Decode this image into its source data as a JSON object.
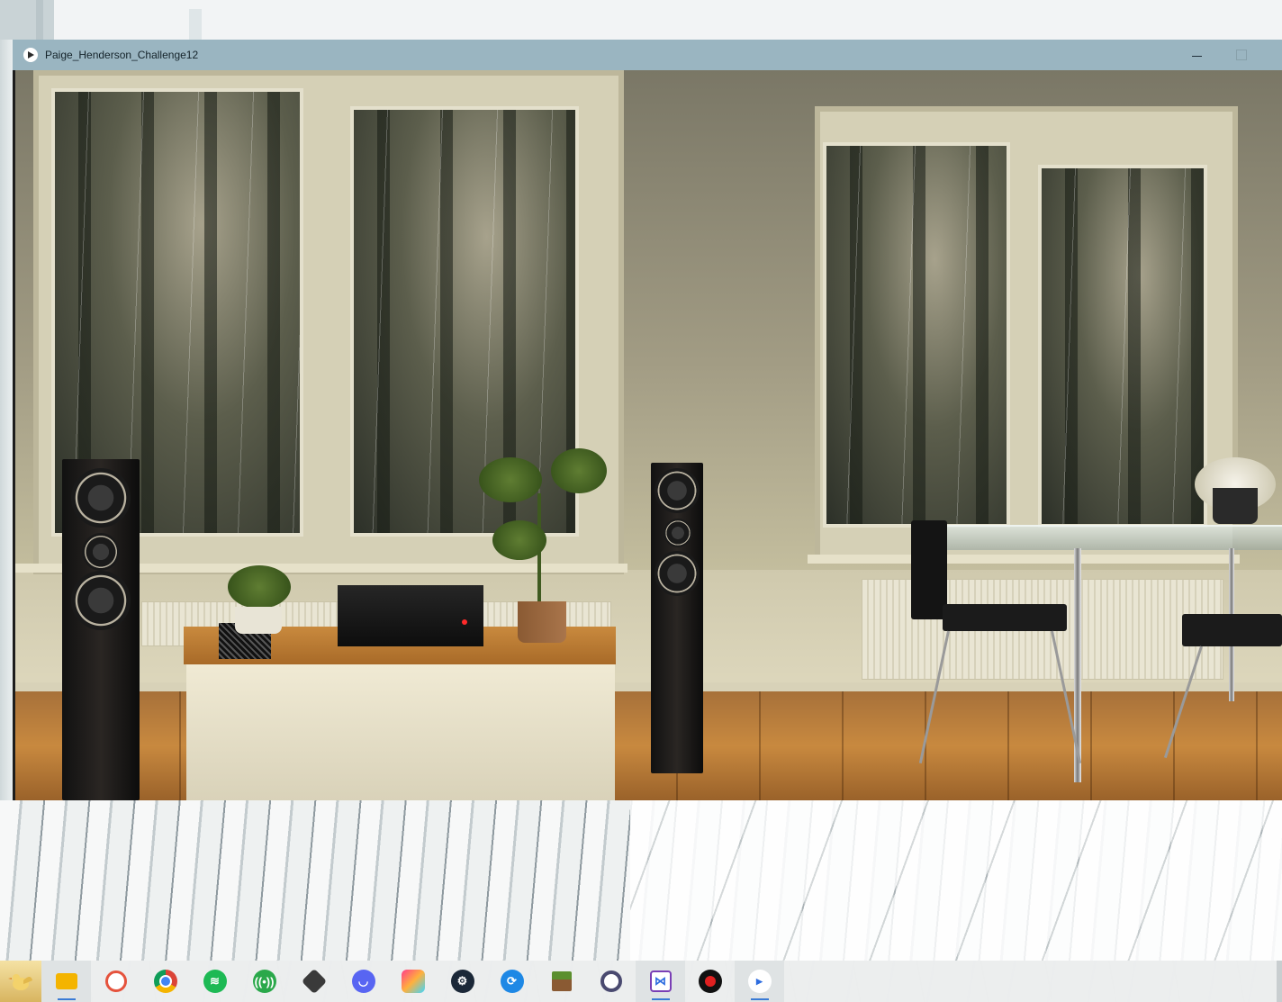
{
  "window": {
    "title": "Paige_Henderson_Challenge12",
    "icon": "play-icon",
    "controls": {
      "minimize_icon": "minimize-icon",
      "maximize_icon": "maximize-icon"
    }
  },
  "video": {
    "content": "rainy-forest-room-scene"
  },
  "taskbar": {
    "start_icon": "start-bird-icon",
    "apps": [
      {
        "name": "file-explorer",
        "icon": "folder-icon",
        "color": "#f4b400"
      },
      {
        "name": "recolored-paint",
        "icon": "spiral-icon",
        "color": "#e5533d"
      },
      {
        "name": "chrome",
        "icon": "chrome-icon",
        "color": "#db4437"
      },
      {
        "name": "spotify",
        "icon": "spotify-icon",
        "color": "#1db954"
      },
      {
        "name": "podcast",
        "icon": "broadcast-icon",
        "color": "#2aa84a"
      },
      {
        "name": "unity",
        "icon": "cube-icon",
        "color": "#333333"
      },
      {
        "name": "discord",
        "icon": "discord-icon",
        "color": "#5865f2"
      },
      {
        "name": "photo-app",
        "icon": "gallery-icon",
        "color": "#ff6a3d"
      },
      {
        "name": "steam",
        "icon": "steam-icon",
        "color": "#1b2838"
      },
      {
        "name": "network",
        "icon": "network-icon",
        "color": "#1e88e5"
      },
      {
        "name": "minecraft",
        "icon": "grass-block-icon",
        "color": "#5b8f2e"
      },
      {
        "name": "obs-style",
        "icon": "ring-icon",
        "color": "#4a4a70"
      },
      {
        "name": "visual-studio",
        "icon": "vs-icon",
        "color": "#7a3fb5"
      },
      {
        "name": "recorder",
        "icon": "record-icon",
        "color": "#e02020"
      },
      {
        "name": "media-player",
        "icon": "play-icon",
        "color": "#2d6cdf"
      }
    ]
  }
}
